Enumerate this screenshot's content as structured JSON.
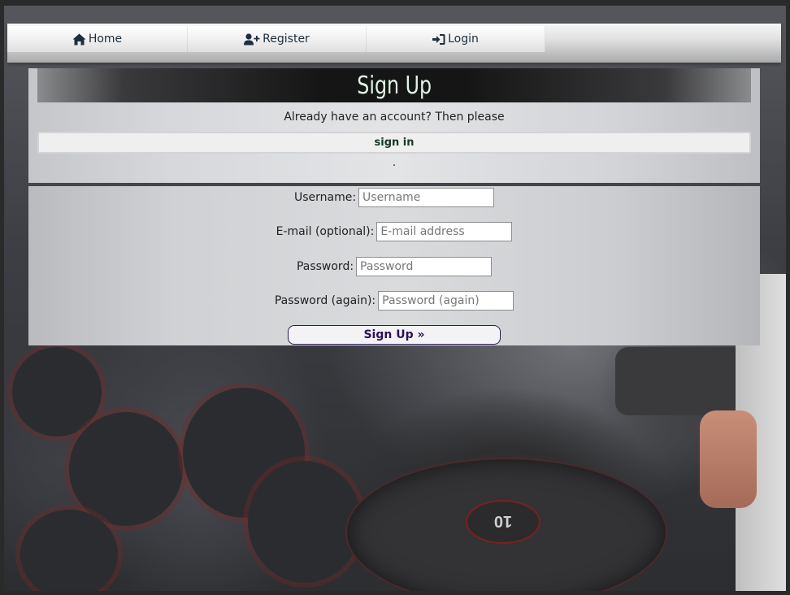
{
  "nav": {
    "home_label": "Home",
    "register_label": "Register",
    "login_label": "Login"
  },
  "signup": {
    "title": "Sign Up",
    "already_text": "Already have an account? Then please",
    "signin_link": "sign in",
    "period": "."
  },
  "form": {
    "username_label": "Username:",
    "username_placeholder": "Username",
    "email_label": "E-mail (optional):",
    "email_placeholder": "E-mail address",
    "password_label": "Password:",
    "password_placeholder": "Password",
    "password2_label": "Password (again):",
    "password2_placeholder": "Password (again)",
    "submit_label": "Sign Up »"
  },
  "background": {
    "plate_label": "10"
  },
  "colors": {
    "title_text": "#dff3e4",
    "signin_text": "#173a24",
    "submit_text": "#2d0f56",
    "nav_text": "#1d2f3e"
  }
}
